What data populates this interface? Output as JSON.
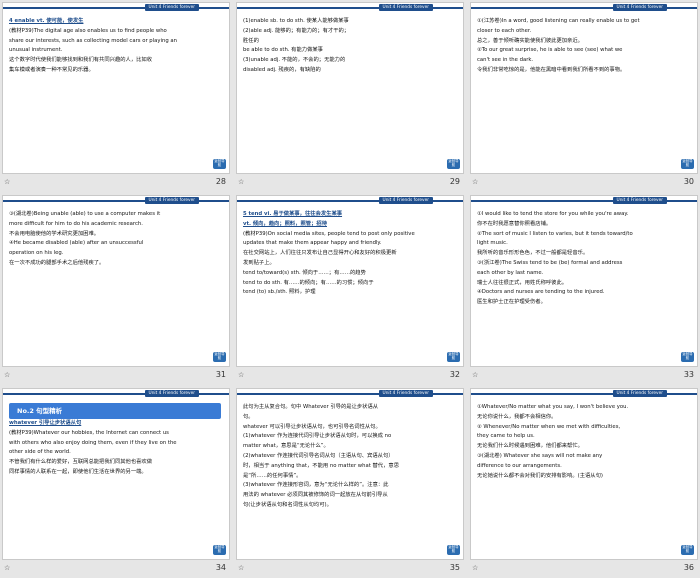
{
  "header_label": "Unit 4   Friends forever",
  "nav_label": "返回导航",
  "slides": [
    {
      "page": "28",
      "lines": [
        {
          "t": "4  enable  vt. 使可能，使发生",
          "cls": "tag"
        },
        {
          "t": "(教材P39)The digital age also enables us to find people who"
        },
        {
          "t": "share our interests, such as collecting model cars or playing an"
        },
        {
          "t": "unusual instrument."
        },
        {
          "t": "这个数字时代使我们能够找到和我们有共同兴趣的人，比如收",
          "cls": "zh"
        },
        {
          "t": "集车模或者演奏一种不常见的乐器。",
          "cls": "zh"
        }
      ]
    },
    {
      "page": "29",
      "lines": [
        {
          "t": "(1)enable sb. to do sth.      使某人能够做某事"
        },
        {
          "t": "(2)able adj.                  能够的；有能力的；有才干的；"
        },
        {
          "t": "                              胜任的"
        },
        {
          "t": "be able to do sth.            有能力做某事"
        },
        {
          "t": "(3)unable adj.                不能的，不会的；无能力的"
        },
        {
          "t": "disabled adj.                 残疾的，有缺陷的"
        }
      ]
    },
    {
      "page": "30",
      "lines": [
        {
          "t": "①(江苏卷)In a word, good listening can really enable us to get"
        },
        {
          "t": "closer to each other."
        },
        {
          "t": "总之，善于倾听确实能使我们彼此更加亲近。"
        },
        {
          "t": "②To our great surprise, he is able  to see  (see) what we"
        },
        {
          "t": "can't see in the dark."
        },
        {
          "t": "令我们非常吃惊的是，他能在黑暗中看到我们所看不到的事物。"
        }
      ]
    },
    {
      "page": "31",
      "lines": [
        {
          "t": "③(湖北卷)Being   unable   (able) to use a computer makes it"
        },
        {
          "t": "more difficult for him to do his academic research."
        },
        {
          "t": "不会用电脑使他的学术研究更加困难。"
        },
        {
          "t": "④He became   disabled   (able)  after  an  unsuccessful"
        },
        {
          "t": "operation on his leg."
        },
        {
          "t": "在一次不成功的腿部手术之后他残疾了。"
        }
      ]
    },
    {
      "page": "32",
      "lines": [
        {
          "t": "5  tend   vi. 易于做某事，往往会发生某事",
          "cls": "tag"
        },
        {
          "t": "          vt. 倾向，趋向；照料，照管；招待",
          "cls": "tag"
        },
        {
          "t": "(教材P39)On social media sites, people tend to post only positive"
        },
        {
          "t": "updates that make them appear happy and friendly."
        },
        {
          "t": "在社交网站上，人们往往只发布让自己显得开心和友好的积极更新"
        },
        {
          "t": "发到贴子上。"
        },
        {
          "t": "tend to/toward(s) sth.     倾向于……；有……的趋势"
        },
        {
          "t": "tend to do sth.            有……的倾向；有……的习惯；倾向于"
        },
        {
          "t": "tend (to) sb./sth.         照料，护理"
        }
      ]
    },
    {
      "page": "33",
      "lines": [
        {
          "t": "①I would like to tend the store for you while you're away."
        },
        {
          "t": "你不在时我愿意替你照看店铺。"
        },
        {
          "t": "②The sort of music I listen to varies, but it tends   toward/to"
        },
        {
          "t": "light music."
        },
        {
          "t": "我所听的音乐形形色色，不过一般都是轻音乐。"
        },
        {
          "t": "③(浙江卷)The Swiss tend   to be   (be) formal and address"
        },
        {
          "t": "each other by last name."
        },
        {
          "t": "瑞士人往往很正式，用姓氏称呼彼此。"
        },
        {
          "t": "④Doctors and nurses are tending   to   the injured."
        },
        {
          "t": "医生和护士正在护理受伤者。"
        }
      ]
    },
    {
      "page": "34",
      "lines": [
        {
          "t": "No.2  句型精析",
          "cls": "banner"
        },
        {
          "t": "whatever 引导让步状语从句",
          "cls": "tag"
        },
        {
          "t": "(教材P39)Whatever our hobbies, the Internet can connect us"
        },
        {
          "t": "with others who also enjoy doing them, even if they live on the"
        },
        {
          "t": "other side of the world."
        },
        {
          "t": "不管我们有什么样的爱好，互联网总能把我们同其他也喜欢做"
        },
        {
          "t": "同样事情的人联系在一起，即使他们生活在世界的另一端。"
        }
      ]
    },
    {
      "page": "35",
      "lines": [
        {
          "t": "    此句为主从复合句。句中 Whatever 引导的是让步状语从"
        },
        {
          "t": "句。"
        },
        {
          "t": "    whatever 可以引导让步状语从句，也可引导名词性从句。"
        },
        {
          "t": "(1)whatever 作为连接代词引导让步状语从句时，可以换成 no"
        },
        {
          "t": "matter what，意思是“无论什么”。"
        },
        {
          "t": "(2)whatever 作连接代词引导名词从句（主语从句、宾语从句）"
        },
        {
          "t": "时，相当于 anything that，不能用 no matter what 替代，意思"
        },
        {
          "t": "是“所……的任何事情”。"
        },
        {
          "t": "(3)whatever 作连接形容词，意为“无论什么样的”。注意：此"
        },
        {
          "t": "用法的 whatever 必须同其被修饰的词一起放在从句前引导从"
        },
        {
          "t": "句(让步状语从句和名词性从句均可)。"
        }
      ]
    },
    {
      "page": "36",
      "lines": [
        {
          "t": "①Whatever/No matter what you say, I won't believe you."
        },
        {
          "t": "无论你说什么，我都不会相信你。"
        },
        {
          "t": "②   Whenever/No matter when   we met with difficulties,"
        },
        {
          "t": "they came to help us."
        },
        {
          "t": "无论我们什么时候遇到困难，他们都来帮忙。"
        },
        {
          "t": "③(湖北卷)   Whatever she says   will not make any"
        },
        {
          "t": "difference to our arrangements."
        },
        {
          "t": "无论她说什么都不会对我们的安排有影响。(主语从句)"
        }
      ]
    }
  ]
}
